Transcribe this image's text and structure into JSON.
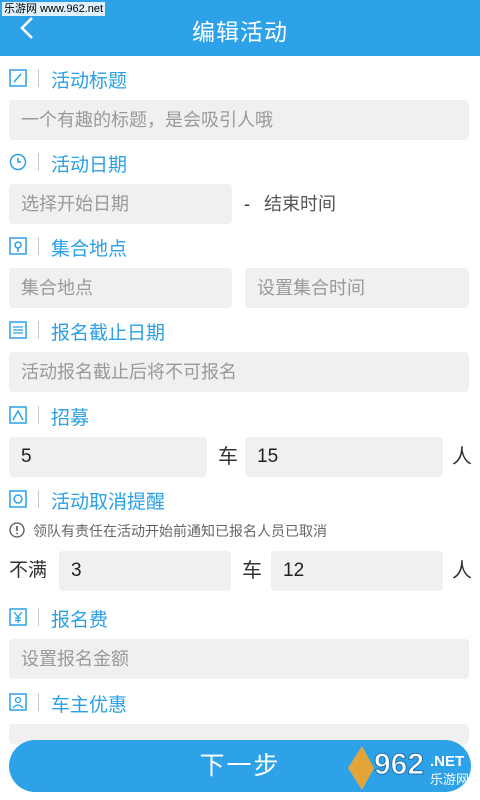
{
  "header": {
    "title": "编辑活动",
    "watermark": "乐游网 www.962.net",
    "back_icon": "chevron-left-icon"
  },
  "colors": {
    "accent": "#2da2e8",
    "field_bg": "#f0f0f0"
  },
  "sections": {
    "title": {
      "label": "活动标题",
      "icon": "edit-icon",
      "placeholder": "一个有趣的标题，是会吸引人哦"
    },
    "date": {
      "label": "活动日期",
      "icon": "clock-icon",
      "start_placeholder": "选择开始日期",
      "dash": "-",
      "end_placeholder": "结束时间"
    },
    "meet": {
      "label": "集合地点",
      "icon": "location-icon",
      "place_placeholder": "集合地点",
      "time_placeholder": "设置集合时间"
    },
    "deadline": {
      "label": "报名截止日期",
      "icon": "calendar-icon",
      "placeholder": "活动报名截止后将不可报名"
    },
    "recruit": {
      "label": "招募",
      "icon": "recruit-icon",
      "cars": "5",
      "car_unit": "车",
      "people": "15",
      "people_unit": "人"
    },
    "cancel": {
      "label": "活动取消提醒",
      "icon": "cancel-icon",
      "notice": "领队有责任在活动开始前通知已报名人员已取消",
      "prefix": "不满",
      "cars": "3",
      "car_unit": "车",
      "people": "12",
      "people_unit": "人"
    },
    "fee": {
      "label": "报名费",
      "icon": "yen-icon",
      "placeholder": "设置报名金额"
    },
    "owner": {
      "label": "车主优惠",
      "icon": "car-owner-icon"
    }
  },
  "footer": {
    "next_label": "下一步",
    "logo_text": "962",
    "logo_sub": "乐游网",
    "logo_net": ".NET"
  }
}
